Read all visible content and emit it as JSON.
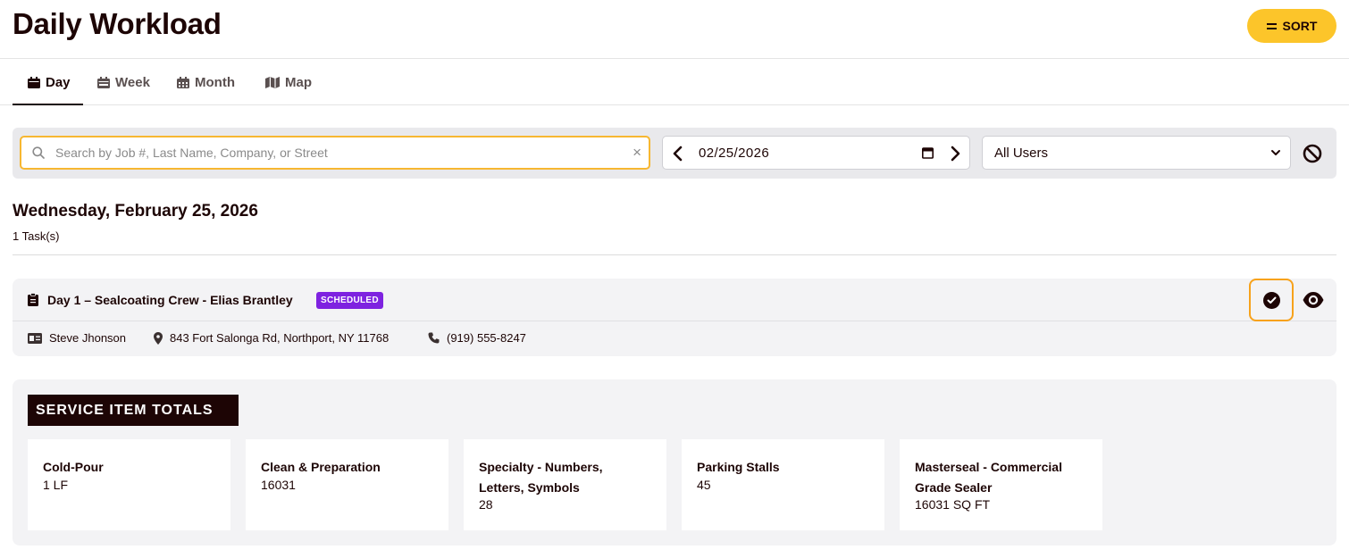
{
  "header": {
    "title": "Daily Workload",
    "sort_label": "SORT"
  },
  "tabs": [
    {
      "label": "Day",
      "icon": "calendar-day-icon",
      "active": true
    },
    {
      "label": "Week",
      "icon": "calendar-week-icon",
      "active": false
    },
    {
      "label": "Month",
      "icon": "calendar-month-icon",
      "active": false
    },
    {
      "label": "Map",
      "icon": "map-icon",
      "active": false
    }
  ],
  "filters": {
    "search_placeholder": "Search by Job #, Last Name, Company, or Street",
    "search_value": "",
    "date": "02/25/2026",
    "user_select": "All Users"
  },
  "schedule": {
    "day_heading": "Wednesday, February 25, 2026",
    "task_count": "1 Task(s)"
  },
  "task": {
    "title": "Day 1 – Sealcoating Crew - Elias Brantley",
    "status": "SCHEDULED",
    "contact": "Steve Jhonson",
    "address": "843 Fort Salonga Rd, Northport, NY 11768",
    "phone": "(919) 555-8247"
  },
  "service_totals": {
    "heading": "SERVICE ITEM TOTALS",
    "items": [
      {
        "name": "Cold-Pour",
        "value": "1 LF"
      },
      {
        "name": "Clean & Preparation",
        "value": "16031"
      },
      {
        "name": "Specialty - Numbers, Letters, Symbols",
        "value": "28"
      },
      {
        "name": "Parking Stalls",
        "value": "45"
      },
      {
        "name": "Masterseal - Commercial Grade Sealer",
        "value": "16031 SQ FT"
      }
    ]
  },
  "colors": {
    "accent": "#fcc52a",
    "focus_border": "#f7b731",
    "status_scheduled": "#7e22e0",
    "dark": "#1d0505"
  }
}
